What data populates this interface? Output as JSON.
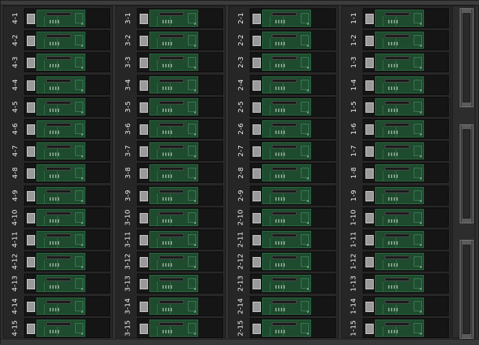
{
  "enclosures": [
    {
      "id": "4",
      "slots": [
        "4-1",
        "4-2",
        "4-3",
        "4-4",
        "4-5",
        "4-6",
        "4-7",
        "4-8",
        "4-9",
        "4-10",
        "4-11",
        "4-12",
        "4-13",
        "4-14",
        "4-15"
      ]
    },
    {
      "id": "3",
      "slots": [
        "3-1",
        "3-2",
        "3-3",
        "3-4",
        "3-5",
        "3-6",
        "3-7",
        "3-8",
        "3-9",
        "3-10",
        "3-11",
        "3-12",
        "3-13",
        "3-14",
        "3-15"
      ]
    },
    {
      "id": "2",
      "slots": [
        "2-1",
        "2-2",
        "2-3",
        "2-4",
        "2-5",
        "2-6",
        "2-7",
        "2-8",
        "2-9",
        "2-10",
        "2-11",
        "2-12",
        "2-13",
        "2-14",
        "2-15"
      ]
    },
    {
      "id": "1",
      "slots": [
        "1-1",
        "1-2",
        "1-3",
        "1-4",
        "1-5",
        "1-6",
        "1-7",
        "1-8",
        "1-9",
        "1-10",
        "1-11",
        "1-12",
        "1-13",
        "1-14",
        "1-15"
      ]
    }
  ],
  "fan_modules": 3,
  "colors": {
    "pcb": "#1e4a2e",
    "chassis": "#303030",
    "label": "#f1f1f1"
  }
}
